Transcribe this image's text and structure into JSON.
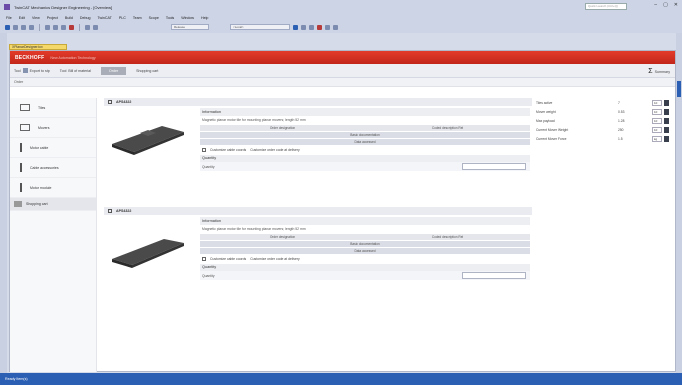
{
  "window": {
    "title": "TwinCAT Mechanics Designer Engineering - [Overview]",
    "search_placeholder": "Quick Launch (Ctrl+Q)",
    "controls": [
      "–",
      "▢",
      "✕"
    ]
  },
  "menu": [
    "File",
    "Edit",
    "View",
    "Project",
    "Build",
    "Debug",
    "TwinCAT",
    "PLC",
    "Team",
    "Scope",
    "Tools",
    "Window",
    "Help"
  ],
  "toolbar": {
    "config_combo": "Release",
    "target_combo": "<Local>"
  },
  "document_tab": "XPlanarDesigner.tcx",
  "brand": {
    "logo": "BECKHOFF",
    "tagline": "New Automation Technology"
  },
  "doc_toolbar": {
    "buttons": [
      "Tool",
      "Export to stp",
      "Tool",
      "Bill of material",
      "Order"
    ],
    "extra_label": "Shopping cart",
    "summary_label": "Summary",
    "summary_symbol": "Σ"
  },
  "section_head": "Order",
  "nav": {
    "items": [
      {
        "label": "Tiles",
        "icon": "tile-icon"
      },
      {
        "label": "Movers",
        "icon": "mover-icon"
      },
      {
        "label": "Motor cable",
        "icon": "cable-icon"
      },
      {
        "label": "Cable accessories",
        "icon": "connector-icon"
      },
      {
        "label": "Motor module",
        "icon": "module-icon"
      }
    ],
    "selected": {
      "label": "Shopping cart",
      "icon": "cart-icon"
    }
  },
  "parts": [
    {
      "id": "APS4322",
      "info_title": "Information",
      "info_desc": "Magnetic planar motor tile for mounting planar movers; length 52 mm",
      "row1_left": "Order designation",
      "row1_right": "Coded description Rel",
      "row2": "Basic documentation",
      "row3": "Data accessed",
      "options": [
        "Customize cable coords",
        "Customize order code at delivery"
      ],
      "qty_title": "Quantity",
      "qty_label": "Quantity"
    },
    {
      "id": "APS4322",
      "info_title": "Information",
      "info_desc": "Magnetic planar motor tile for mounting planar movers; length 52 mm",
      "row1_left": "Order designation",
      "row1_right": "Coded description Rel",
      "row2": "Basic documentation",
      "row3": "Data accessed",
      "options": [
        "Customize cable coords",
        "Customize order code at delivery"
      ],
      "qty_title": "Quantity",
      "qty_label": "Quantity"
    }
  ],
  "properties": [
    {
      "label": "Tiles active",
      "value": "7",
      "box": "10"
    },
    {
      "label": "Mover weight",
      "value": "0.53",
      "box": "10"
    },
    {
      "label": "Max payload",
      "value": "1.28",
      "box": "10"
    },
    {
      "label": "Current Mover Weight",
      "value": "250",
      "box": "10"
    },
    {
      "label": "Current Mover Force",
      "value": "1.5",
      "box": "kg"
    }
  ],
  "status": "Ready  Item(s)"
}
